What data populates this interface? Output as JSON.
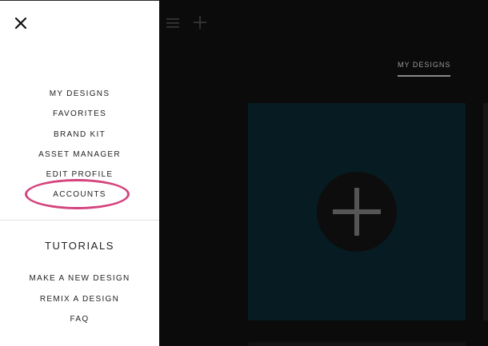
{
  "colors": {
    "menu_background": "#ffffff",
    "main_background": "#0b0b0b",
    "card_background": "#061b22",
    "highlight_ring": "#d4447e"
  },
  "side_menu": {
    "close_icon": "close-icon",
    "items": [
      {
        "label": "MY DESIGNS"
      },
      {
        "label": "FAVORITES"
      },
      {
        "label": "BRAND KIT"
      },
      {
        "label": "ASSET MANAGER"
      },
      {
        "label": "EDIT PROFILE"
      },
      {
        "label": "ACCOUNTS",
        "highlighted": true
      }
    ],
    "tutorials": {
      "title": "TUTORIALS",
      "items": [
        {
          "label": "MAKE A NEW DESIGN"
        },
        {
          "label": "REMIX A DESIGN"
        },
        {
          "label": "FAQ"
        }
      ]
    }
  },
  "main": {
    "topbar": {
      "menu_icon": "hamburger-icon",
      "add_icon": "plus-icon"
    },
    "tabs": [
      {
        "label": "MY DESIGNS",
        "active": true
      }
    ],
    "new_design_card": {
      "icon": "plus-icon"
    }
  }
}
